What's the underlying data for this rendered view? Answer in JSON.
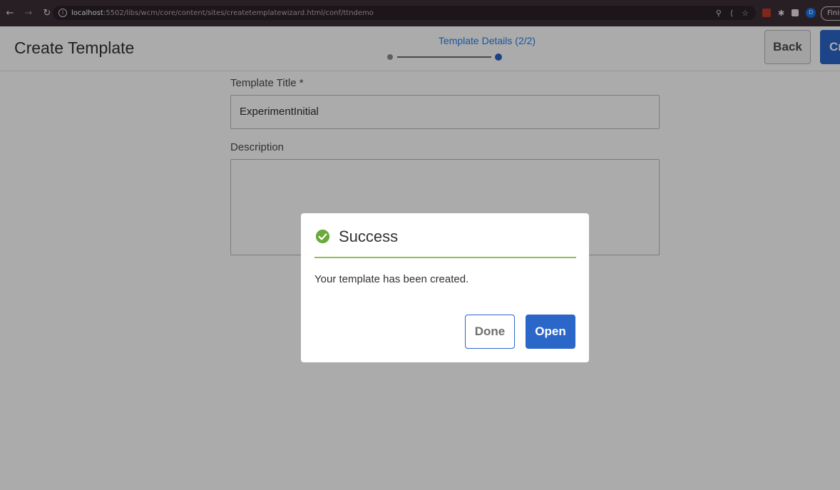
{
  "browser": {
    "url_host": "localhost",
    "url_rest": ":5502/libs/wcm/core/content/sites/createtemplatewizard.html/conf/ttndemo",
    "finish_label": "Finis",
    "profile_initial": "D",
    "icons": [
      "back-icon",
      "forward-icon",
      "reload-icon",
      "info-icon",
      "zoom-icon",
      "share-icon",
      "star-icon",
      "extension-icon",
      "puzzle-icon",
      "sidebar-icon"
    ]
  },
  "header": {
    "title": "Create Template",
    "step_title": "Template Details (2/2)",
    "back_label": "Back",
    "create_label": "Cr",
    "accent_color": "#2b66c9"
  },
  "form": {
    "title_label": "Template Title *",
    "title_value": "ExperimentInitial",
    "description_label": "Description",
    "description_value": ""
  },
  "dialog": {
    "title": "Success",
    "message": "Your template has been created.",
    "done_label": "Done",
    "open_label": "Open",
    "success_color": "#8bc34a",
    "icon": "check-circle-icon"
  }
}
